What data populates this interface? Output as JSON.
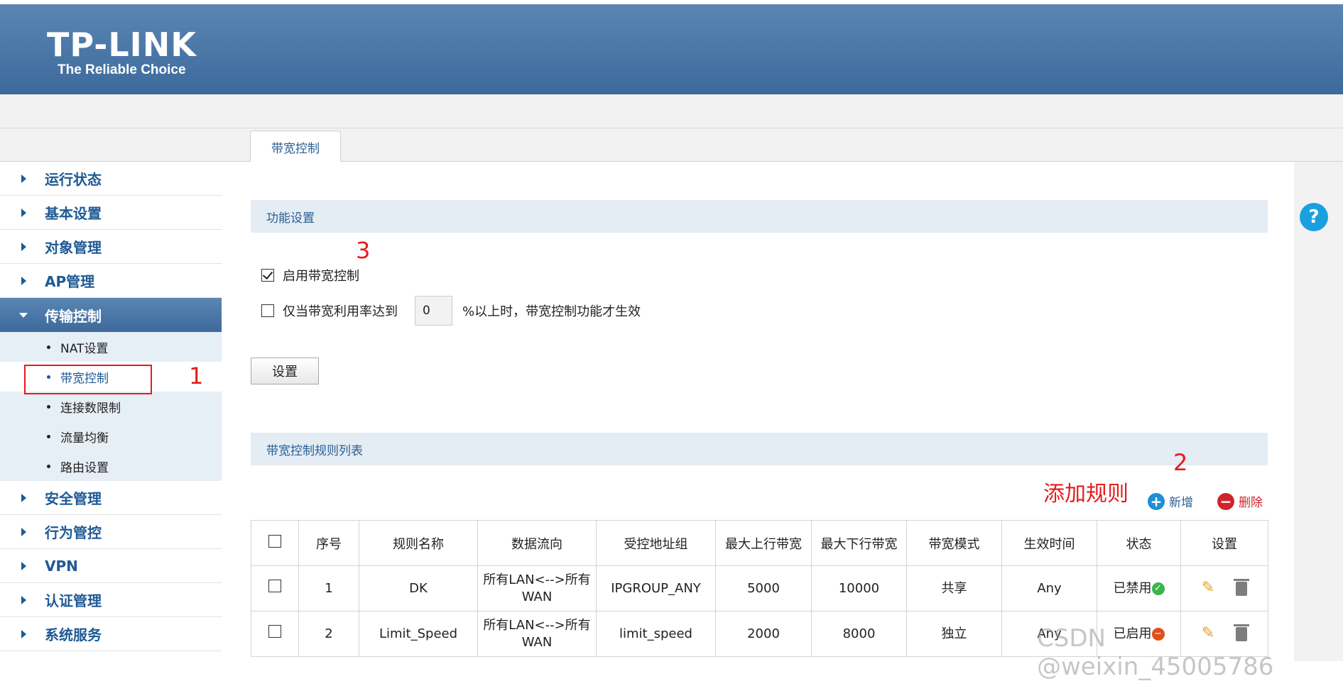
{
  "brand": {
    "logo_main": "TP-LINK",
    "logo_sub": "The Reliable Choice"
  },
  "tab": {
    "label": "带宽控制"
  },
  "sidebar": {
    "items_top": [
      "运行状态",
      "基本设置",
      "对象管理",
      "AP管理"
    ],
    "active": "传输控制",
    "sub_items": [
      "NAT设置",
      "带宽控制",
      "连接数限制",
      "流量均衡",
      "路由设置"
    ],
    "items_bottom": [
      "安全管理",
      "行为管控",
      "VPN",
      "认证管理",
      "系统服务"
    ]
  },
  "help": {
    "label": "?"
  },
  "func": {
    "title": "功能设置",
    "enable_label": "启用带宽控制",
    "threshold_label": "仅当带宽利用率达到",
    "threshold_value": "0",
    "threshold_suffix": "%以上时，带宽控制功能才生效",
    "set_button": "设置"
  },
  "rules": {
    "title": "带宽控制规则列表",
    "add_label": "新增",
    "delete_label": "删除",
    "headers": [
      "序号",
      "规则名称",
      "数据流向",
      "受控地址组",
      "最大上行带宽",
      "最大下行带宽",
      "带宽模式",
      "生效时间",
      "状态",
      "设置"
    ],
    "rows": [
      {
        "no": "1",
        "name": "DK",
        "flow": "所有LAN<-->所有WAN",
        "group": "IPGROUP_ANY",
        "up": "5000",
        "down": "10000",
        "mode": "共享",
        "time": "Any",
        "status": "已禁用"
      },
      {
        "no": "2",
        "name": "Limit_Speed",
        "flow": "所有LAN<-->所有WAN",
        "group": "limit_speed",
        "up": "2000",
        "down": "8000",
        "mode": "独立",
        "time": "Any",
        "status": "已启用"
      }
    ]
  },
  "annotations": {
    "a1": "1",
    "a2": "2",
    "a3": "3",
    "add_rule": "添加规则"
  },
  "watermark": "CSDN @weixin_45005786"
}
